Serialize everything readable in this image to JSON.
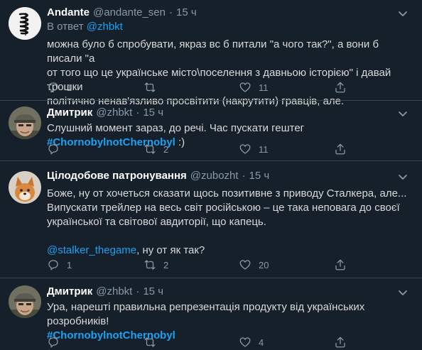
{
  "tweets": [
    {
      "name": "Andante",
      "handle": "@andante_sen",
      "separator": "·",
      "time": "15 ч",
      "reply_prefix": "В ответ",
      "reply_to": "@zhbkt",
      "lines": [
        "можна було б спробувати, якраз вс б питали \"а чого так?\", а вони б писали \"а",
        "от того що це українське місто\\поселення з давньою історією\" і давай трошки",
        "політично ненав'язливо просвітити (накрутити) гравців, але."
      ],
      "replies": "1",
      "retweets": "",
      "likes": "11",
      "avatar": "scribble-logo"
    },
    {
      "name": "Дмитрик",
      "handle": "@zhbkt",
      "separator": "·",
      "time": "15 ч",
      "text_before": "Слушний момент зараз, до речі. Час пускати гештег ",
      "hashtag": "#ChornobylnotChernobyl",
      "text_after": " :)",
      "replies": "",
      "retweets": "2",
      "likes": "11",
      "avatar": "man-in-cap"
    },
    {
      "name": "Цілодобове патронування",
      "handle": "@zubozht",
      "separator": "·",
      "time": "15 ч",
      "lines": [
        "Боже, ну от хочеться сказати щось позитивне з приводу Сталкера, але...",
        "Випускати трейлер на весь світ російською – це така неповага до своєї",
        "української та світової авдиторії, що капець."
      ],
      "mention": "@stalker_thegame",
      "mention_after": ", ну от як так?",
      "replies": "1",
      "retweets": "2",
      "likes": "20",
      "avatar": "shiba-dog"
    },
    {
      "name": "Дмитрик",
      "handle": "@zhbkt",
      "separator": "·",
      "time": "15 ч",
      "line1": "Ура, нарешті правильна репрезентація продукту від українських розробників!",
      "hashtag": "#ChornobylnotChernobyl",
      "replies": "",
      "retweets": "",
      "likes": "4",
      "avatar": "man-in-cap"
    }
  ],
  "colors": {
    "background": "#15202b",
    "text": "#d9d9d9",
    "secondary": "#8899a6",
    "accent": "#1da1f2",
    "divider": "#38444d"
  },
  "icons": [
    "reply-icon",
    "retweet-icon",
    "like-icon",
    "share-icon",
    "more-caret-icon"
  ]
}
